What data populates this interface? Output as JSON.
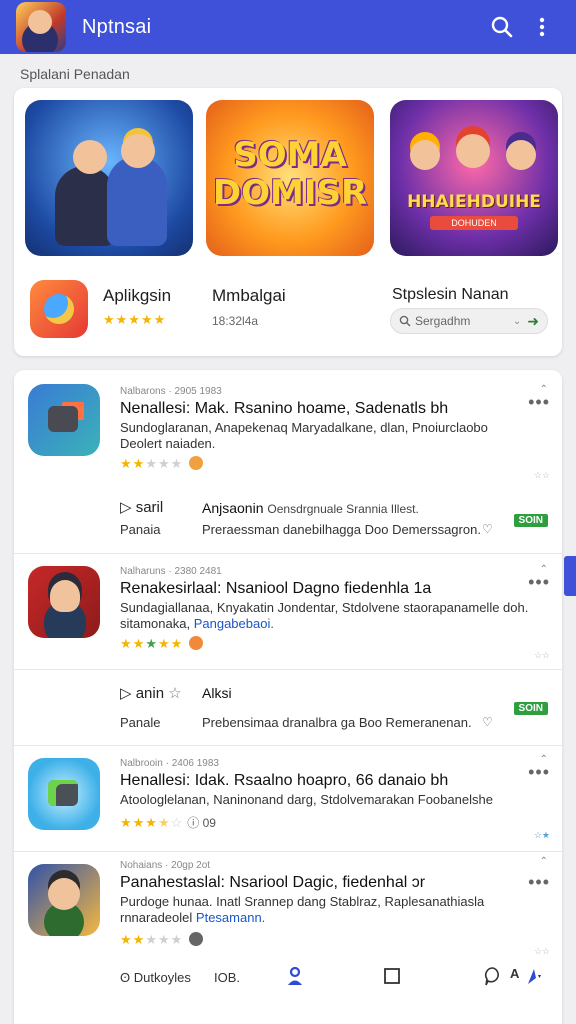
{
  "appbar": {
    "title": "Nptnsai",
    "search_icon": "search-icon",
    "menu_icon": "more-vert-icon"
  },
  "section_title": "Splalani Penadan",
  "featured": {
    "banners": [
      {
        "label": ""
      },
      {
        "label": "SOMA DOMISR"
      },
      {
        "label": "HHAIEHDUIHE",
        "sub": "DOHUDEN"
      }
    ],
    "items": [
      {
        "name": "Aplikgsin",
        "stars": "★★★★★"
      },
      {
        "name": "Mmbalgai",
        "sub": "18:32l4a"
      },
      {
        "name": "Stpslesin Nanan",
        "search_text": "Sergadhm"
      }
    ]
  },
  "list": [
    {
      "meta": "Nalbarons · 2905 1983",
      "name": "Nenallesi: Mak. Rsanino hoame, Sadenatls bh",
      "desc": "Sundoglaranan, Anapekenaq Maryadalkane, dlan, Pnoiurclaobo Deolert naiaden.",
      "rating": {
        "filled": 2,
        "total": 5
      }
    },
    {
      "play_label": "saril",
      "small_label": "Panaia",
      "action_name": "Anjsaonin",
      "action_name_thin": "Oensdrgnuale Srannia Illest.",
      "action_desc": "Preraessman danebilhagga Doo Demerssagron.",
      "badge": "SOIN"
    },
    {
      "meta": "Nalharuns · 2380 2481",
      "name": "Renakesirlaal: Nsaniool Dagno fiedenhla 1a",
      "desc": "Sundagiallanaa, Knyakatin Jondentar, Stdolvene staorapanamelle doh. sitamonaka,",
      "desc_link": "Pangabebaoi.",
      "rating": {
        "filled": 5,
        "total": 5
      }
    },
    {
      "play_label": "anin",
      "small_label": "Panale",
      "action_name": "Alksi",
      "action_desc": "Prebensimaa dranalbra ga Boo Remeranenan.",
      "badge": "SOIN"
    },
    {
      "meta": "Nalbrooin · 2406 1983",
      "name": "Henallesi: Idak. Rsaalno hoapro, 66 danaio bh",
      "desc": "Atoologlelanan, Naninonand darg, Stdolvemarakan Foobanelshe",
      "rating": {
        "filled": 3.5,
        "total": 5
      },
      "score": "09"
    },
    {
      "meta": "Nohaians · 20gp 2ot",
      "name": "Panahestaslal: Nsariool Dagic, fiedenhal ɔr",
      "desc": "Purdoge hunaa. Inatl Srannep dang Stablraz, Raplesanathiasla rnnaradeolel",
      "desc_link": "Ptesamann.",
      "rating": {
        "filled": 2,
        "total": 5
      }
    }
  ],
  "bottomnav": {
    "label1": "Dutkoyles",
    "label2": "IOB."
  }
}
